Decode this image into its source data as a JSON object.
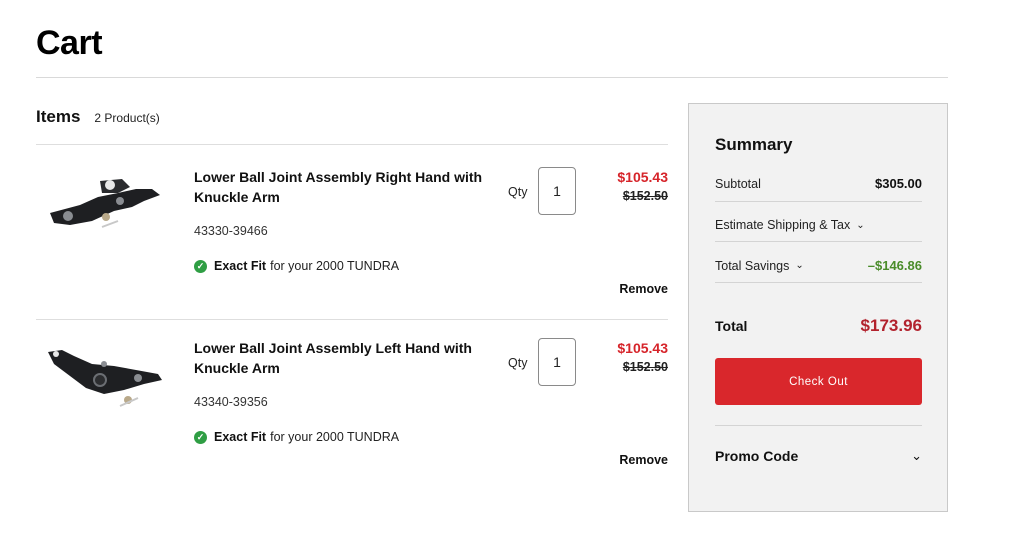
{
  "page": {
    "title": "Cart"
  },
  "items_header": {
    "label": "Items",
    "count": "2 Product(s)"
  },
  "products": [
    {
      "name": "Lower Ball Joint Assembly Right Hand with Knuckle Arm",
      "part_number": "43330-39466",
      "fit_strong": "Exact Fit",
      "fit_text": "for your 2000 TUNDRA",
      "qty_label": "Qty",
      "qty": "1",
      "sale_price": "$105.43",
      "original_price": "$152.50",
      "remove_label": "Remove"
    },
    {
      "name": "Lower Ball Joint Assembly Left Hand with Knuckle Arm",
      "part_number": "43340-39356",
      "fit_strong": "Exact Fit",
      "fit_text": "for your 2000 TUNDRA",
      "qty_label": "Qty",
      "qty": "1",
      "sale_price": "$105.43",
      "original_price": "$152.50",
      "remove_label": "Remove"
    }
  ],
  "summary": {
    "title": "Summary",
    "subtotal_label": "Subtotal",
    "subtotal_value": "$305.00",
    "shipping_label": "Estimate Shipping & Tax",
    "savings_label": "Total Savings",
    "savings_value": "–$146.86",
    "total_label": "Total",
    "total_value": "$173.96",
    "checkout_label": "Check Out",
    "promo_label": "Promo Code"
  },
  "icons": {
    "fit_check": "check-circle-icon",
    "chevron": "chevron-down-icon"
  },
  "colors": {
    "accent_red": "#d9272c",
    "sale_red": "#d6242a",
    "total_red": "#b2222d",
    "savings_green": "#4a8c2a",
    "fit_green": "#2f9e44"
  }
}
